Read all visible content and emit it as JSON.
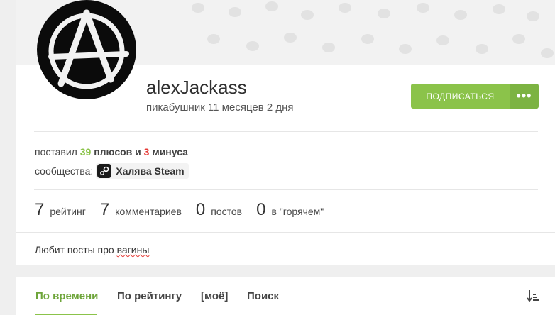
{
  "profile": {
    "username": "alexJackass",
    "subtitle": "пикабушник 11 месяцев 2 дня",
    "subscribe_label": "Подписаться",
    "more_label": "•••"
  },
  "stats": {
    "prefix": "поставил",
    "pluses": "39",
    "pluses_label": "плюсов и",
    "minuses": "3",
    "minuses_label": "минуса",
    "pluses_color": "#8bc34a",
    "minuses_color": "#e53935"
  },
  "communities": {
    "label": "сообщества:",
    "items": [
      {
        "name": "Халява Steam",
        "icon": "steam-icon"
      }
    ]
  },
  "counters": [
    {
      "value": "7",
      "label": "рейтинг"
    },
    {
      "value": "7",
      "label": "комментариев"
    },
    {
      "value": "0",
      "label": "постов"
    },
    {
      "value": "0",
      "label": "в \"горячем\""
    }
  ],
  "about": {
    "prefix": "Любит посты про ",
    "misspelled": "вагины"
  },
  "tabs": [
    {
      "label": "По времени",
      "active": true
    },
    {
      "label": "По рейтингу",
      "active": false
    },
    {
      "label": "[моё]",
      "active": false
    },
    {
      "label": "Поиск",
      "active": false
    }
  ],
  "icons": {
    "avatar": "anarchy-symbol",
    "sort": "sort-icon"
  },
  "colors": {
    "accent": "#8bc34a",
    "accent_dark": "#7cb342",
    "minus": "#e53935"
  }
}
